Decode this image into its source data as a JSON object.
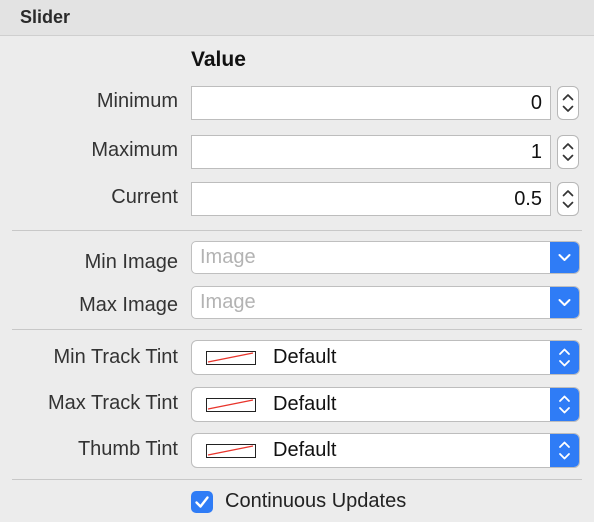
{
  "header": {
    "title": "Slider"
  },
  "value_section": {
    "title": "Value",
    "fields": [
      {
        "label": "Minimum",
        "value": "0"
      },
      {
        "label": "Maximum",
        "value": "1"
      },
      {
        "label": "Current",
        "value": "0.5"
      }
    ]
  },
  "image_section": {
    "fields": [
      {
        "label": "Min Image",
        "placeholder": "Image"
      },
      {
        "label": "Max Image",
        "placeholder": "Image"
      }
    ]
  },
  "tint_section": {
    "fields": [
      {
        "label": "Min Track Tint",
        "value": "Default"
      },
      {
        "label": "Max Track Tint",
        "value": "Default"
      },
      {
        "label": "Thumb Tint",
        "value": "Default"
      }
    ]
  },
  "options": {
    "continuous_updates": {
      "label": "Continuous Updates",
      "checked": true
    }
  },
  "colors": {
    "accent": "#2f7cf6",
    "swatch_slash": "#e8342b"
  },
  "icons": {
    "stepper": "stepper-arrows-icon",
    "combo": "chevron-down-icon",
    "popup": "updown-chevrons-icon",
    "checkbox": "checkmark-icon",
    "swatch": "no-color-swatch-icon"
  }
}
